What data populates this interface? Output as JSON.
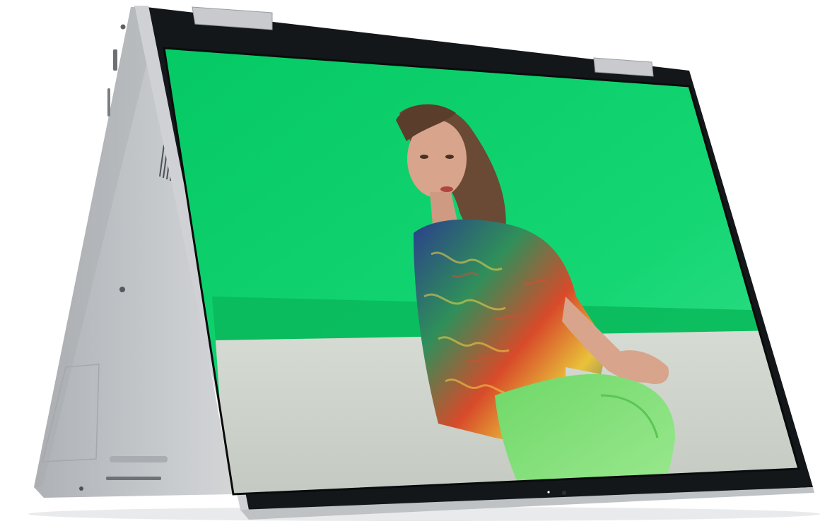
{
  "product": {
    "description_name": "convertible-laptop-tent-mode",
    "body_color": "#b9bcbf",
    "body_shadow": "#8f9397",
    "bezel_color": "#101214",
    "hinge_color": "#c7c9cc"
  },
  "screen": {
    "wallpaper_green": "#10d46f",
    "floor_color": "#cfd4cc",
    "subject": {
      "shirt_colors": [
        "#2a3f8c",
        "#2f8f5a",
        "#d84a2a",
        "#e9c23a"
      ],
      "pants_color": "#7fe07a",
      "skin_color": "#d8a48c",
      "hair_color": "#6a4a34"
    }
  }
}
